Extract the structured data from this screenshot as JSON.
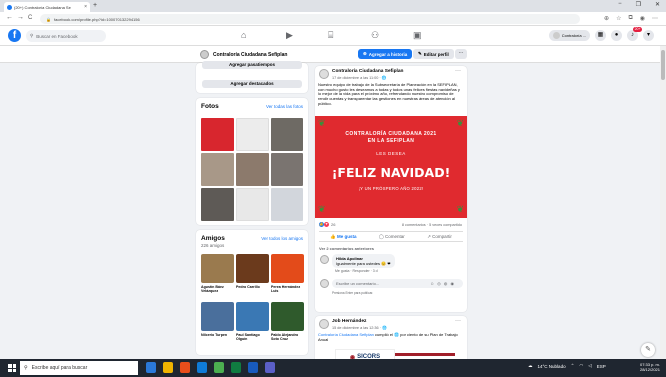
{
  "browser": {
    "tab_title": "(20+) Contraloría Ciudadana Se",
    "close": "×",
    "new_tab": "+",
    "url": "facebook.com/profile.php?id=100070132294156",
    "lock": "🔒",
    "nav": {
      "back": "←",
      "forward": "→",
      "reload": "C"
    },
    "window": {
      "min": "−",
      "restore": "❐",
      "close": "✕"
    }
  },
  "fb": {
    "logo": "f",
    "search_placeholder": "Buscar en Facebook",
    "account_name": "Contraloría ...",
    "notif_count": "20+",
    "menu_icon": "▦",
    "messenger_icon": "●",
    "bell_icon": "♪"
  },
  "page": {
    "name": "Contraloría Ciudadana Sefiplan",
    "btn_history": "Agregar a historia",
    "btn_edit": "Editar perfil",
    "btn_more": "···"
  },
  "left": {
    "intro": {
      "btn1": "Agregar pasatiempos",
      "btn2": "Agregar destacados"
    },
    "photos": {
      "title": "Fotos",
      "link": "Ver todas las fotos"
    },
    "friends": {
      "title": "Amigos",
      "link": "Ver todos los amigos",
      "count": "226 amigos",
      "list": [
        {
          "name": "Agustín Báez Velázquez"
        },
        {
          "name": "Pedro Carrillo"
        },
        {
          "name": "Perea Hernández Luis"
        },
        {
          "name": "Nilcerio Turpen"
        },
        {
          "name": "Paul Santiago Olguín"
        },
        {
          "name": "Pablo Alejandro Soto Cruz"
        }
      ]
    }
  },
  "post1": {
    "author": "Contraloría Ciudadana Sefiplan",
    "date": "17 de diciembre a las 11:00 · 🌐",
    "dots": "···",
    "text": "Nuestro equipo de trabajo de la Subsecretaría de Planeación en la SEFIPLAN, con mucho gusto les deseamos a todas y todos unas felices fiestas navideñas y lo mejor de la vida para el próximo año, refrendando nuestro compromiso de rendir cuentas y transparentar las gestiones en nuestras áreas de atención al público.",
    "image": {
      "line1": "CONTRALORÍA CIUDADANA 2021",
      "line2": "EN LA SEFIPLAN",
      "line3": "LES DESEA",
      "line4": "¡FELIZ NAVIDAD!",
      "line5": "¡Y UN PRÓSPERO AÑO 2022!"
    },
    "reaction_count": "26",
    "stats": "8 comentarios · 5 veces compartido",
    "actions": {
      "like": "Me gusta",
      "comment": "Comentar",
      "share": "Compartir"
    },
    "prev_comments": "Ver 2 comentarios anteriores",
    "comment": {
      "author": "Hilda Apolinar",
      "text": "Igualmente para ustedes 😊 ❤",
      "actions": "Me gusta · Responder · 3 d"
    },
    "write_placeholder": "Escribe un comentario...",
    "write_icons": "☺ ◎ ◍ ◉",
    "enter_hint": "Presiona Enter para publicar."
  },
  "post2": {
    "author": "Job Hernández",
    "date": "15 de diciembre a las 12:36 · 🌐",
    "dots": "···",
    "text_link": "Contraloría Ciudadana Sefiplan",
    "text_rest": " cumplió el 🌐 por ciento de su Plan de Trabajo Anual",
    "logo_text": "SICORS"
  },
  "taskbar": {
    "search": "Escribe aquí para buscar",
    "weather": "14°C  Nublado",
    "lang": "ESP",
    "time": "07:33 p. m.",
    "date": "28/12/2021"
  },
  "chat_icon": "✎"
}
